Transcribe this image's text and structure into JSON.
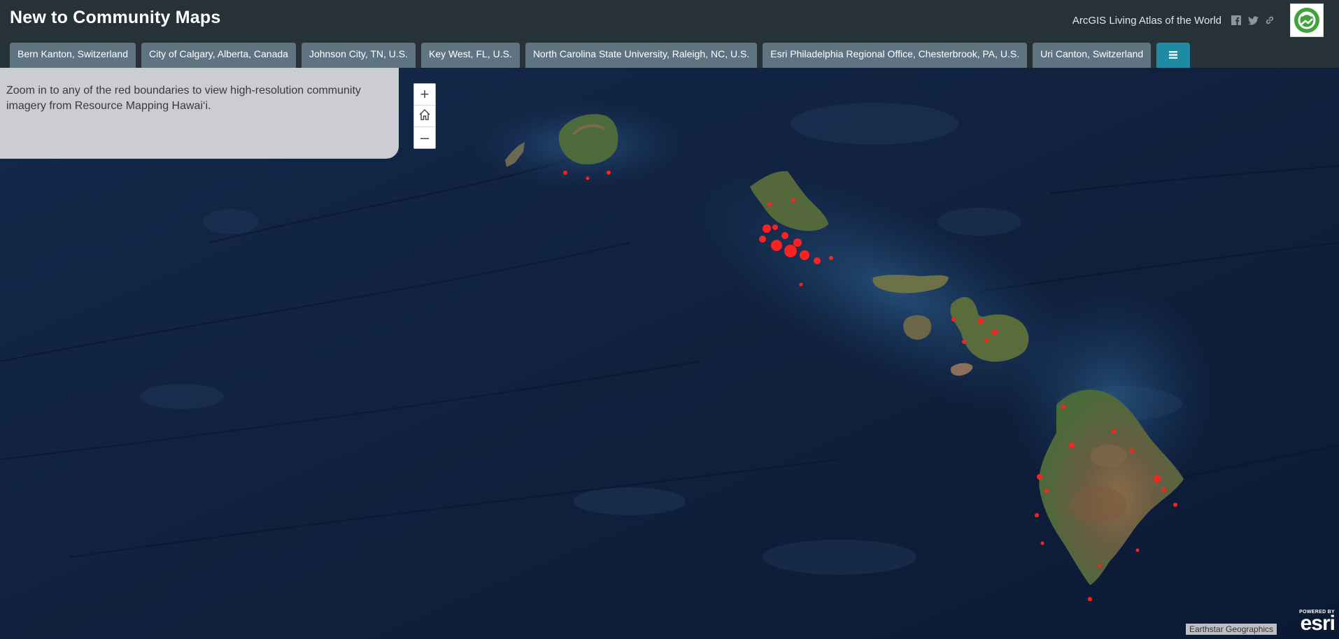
{
  "header": {
    "title": "New to Community Maps",
    "atlas_link": "ArcGIS Living Atlas of the World",
    "icons": [
      "facebook-icon",
      "twitter-icon",
      "link-icon",
      "living-atlas-logo"
    ]
  },
  "tabs": [
    {
      "label": "Bern Kanton, Switzerland"
    },
    {
      "label": "City of Calgary, Alberta, Canada"
    },
    {
      "label": "Johnson City, TN, U.S."
    },
    {
      "label": "Key West, FL, U.S."
    },
    {
      "label": "North Carolina State University, Raleigh, NC, U.S."
    },
    {
      "label": "Esri Philadelphia Regional Office, Chesterbrook, PA, U.S."
    },
    {
      "label": "Uri Canton, Switzerland"
    }
  ],
  "menu_icon": "menu-icon",
  "info_panel": {
    "text": "Zoom in to any of the red boundaries to view high-resolution community imagery from Resource Mapping Hawai‘i."
  },
  "map_controls": {
    "zoom_in": "+",
    "home_icon": "home-icon",
    "zoom_out": "–"
  },
  "attribution": "Earthstar Geographics",
  "esri": {
    "powered": "POWERED BY",
    "word": "esri"
  },
  "colors": {
    "header_bg": "#263238",
    "tab_bg": "#5f7481",
    "tab_active": "#1f8aa3",
    "ocean": "#0d1e38",
    "boundary_red": "#ff2020"
  }
}
